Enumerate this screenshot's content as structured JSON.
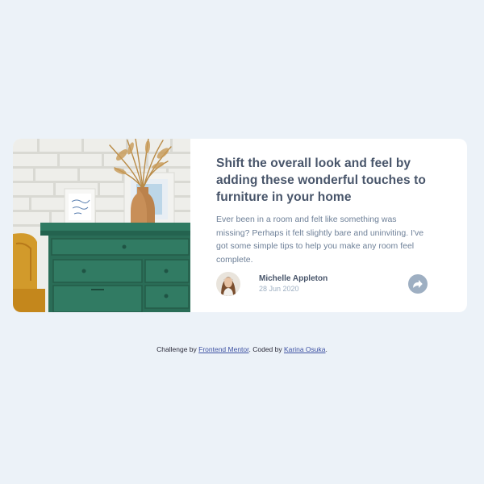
{
  "article": {
    "title": "Shift the overall look and feel by adding these wonderful touches to furniture in your home",
    "description": "Ever been in a room and felt like something was missing? Perhaps it felt slightly bare and uninviting. I've got some simple tips to help you make any room feel complete."
  },
  "author": {
    "name": "Michelle Appleton",
    "date": "28 Jun 2020"
  },
  "share": {
    "icon": "share-icon"
  },
  "attribution": {
    "prefix": "Challenge by ",
    "frontend_mentor": "Frontend Mentor",
    "middle": ". Coded by ",
    "coder": "Karina Osuka",
    "suffix": "."
  },
  "colors": {
    "background": "#ecf2f8",
    "card": "#ffffff",
    "title": "#48556a",
    "text": "#6e8098",
    "muted": "#9eafc2",
    "link": "#3e52a3"
  }
}
